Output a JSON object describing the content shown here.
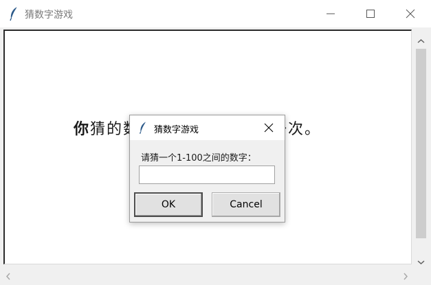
{
  "window": {
    "title": "猜数字游戏",
    "icon": "feather-icon"
  },
  "main": {
    "message_first": "你",
    "message_rest": "猜的数字太小了，请再猜一次。"
  },
  "dialog": {
    "title": "猜数字游戏",
    "icon": "feather-icon",
    "prompt": "请猜一个1-100之间的数字：",
    "input_value": "",
    "ok_label": "OK",
    "cancel_label": "Cancel"
  },
  "colors": {
    "title_text": "#7a7a7a",
    "window_bg": "#f0f0f0",
    "scroll_thumb": "#cdcdcd",
    "button_bg": "#e1e1e1"
  }
}
